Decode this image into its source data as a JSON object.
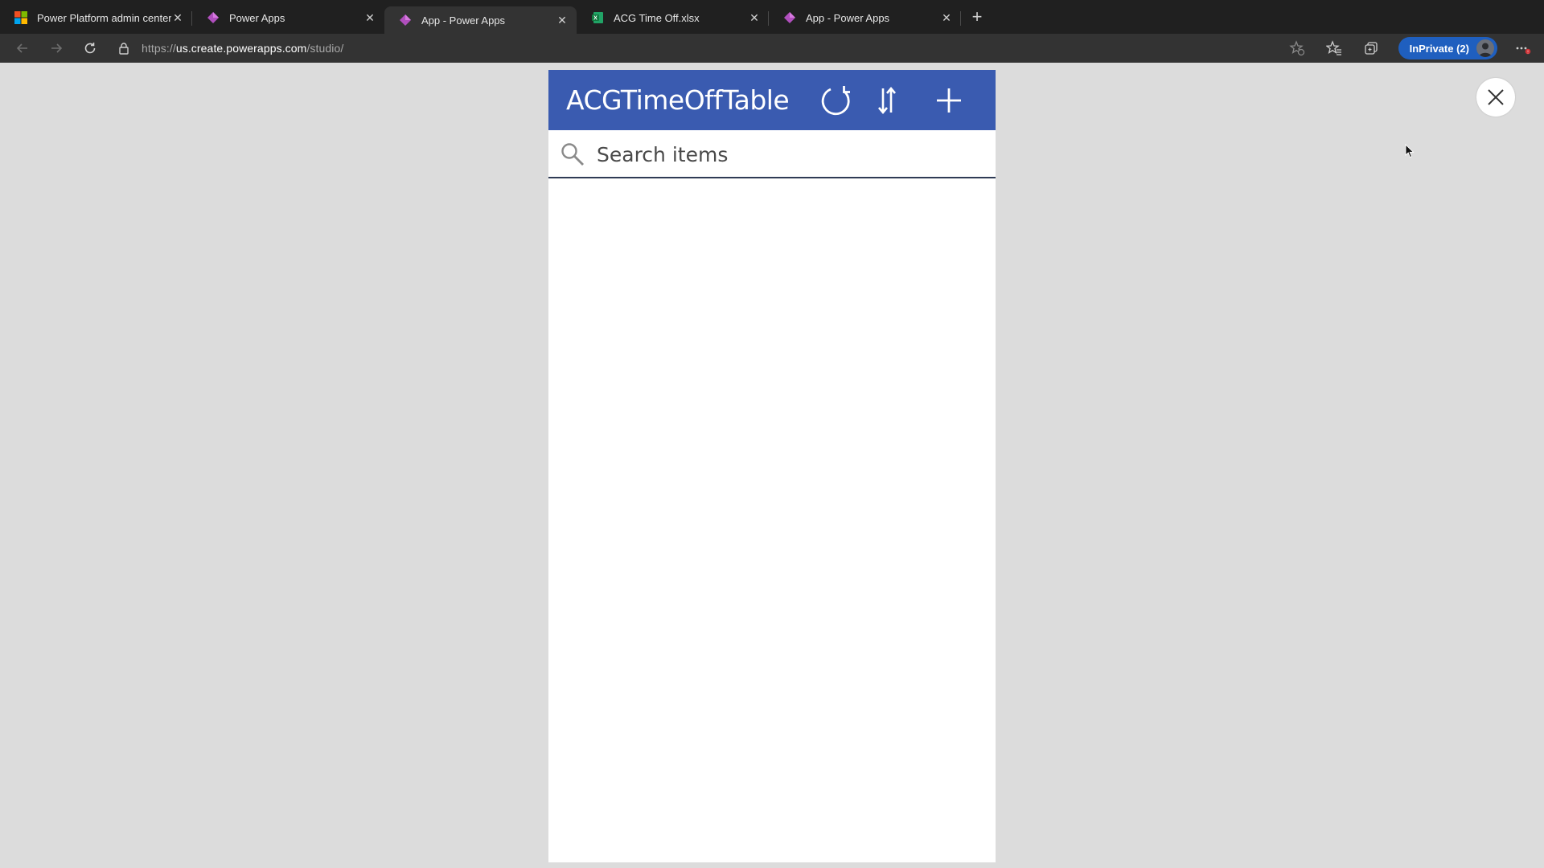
{
  "browser": {
    "tabs": [
      {
        "title": "Power Platform admin center",
        "icon": "microsoft-logo-icon",
        "active": false
      },
      {
        "title": "Power Apps",
        "icon": "power-apps-icon",
        "active": false
      },
      {
        "title": "App - Power Apps",
        "icon": "power-apps-icon",
        "active": true
      },
      {
        "title": "ACG Time Off.xlsx",
        "icon": "excel-icon",
        "active": false
      },
      {
        "title": "App - Power Apps",
        "icon": "power-apps-icon",
        "active": false
      }
    ],
    "url": {
      "scheme": "https://",
      "host": "us.create.powerapps.com",
      "path": "/studio/"
    },
    "inprivate_label": "InPrivate (2)"
  },
  "app": {
    "title": "ACGTimeOffTable",
    "search_placeholder": "Search items",
    "header_color": "#3a5bb0",
    "icons": [
      "refresh-icon",
      "sort-icon",
      "add-icon"
    ]
  },
  "preview": {
    "close_icon": "close-icon"
  }
}
